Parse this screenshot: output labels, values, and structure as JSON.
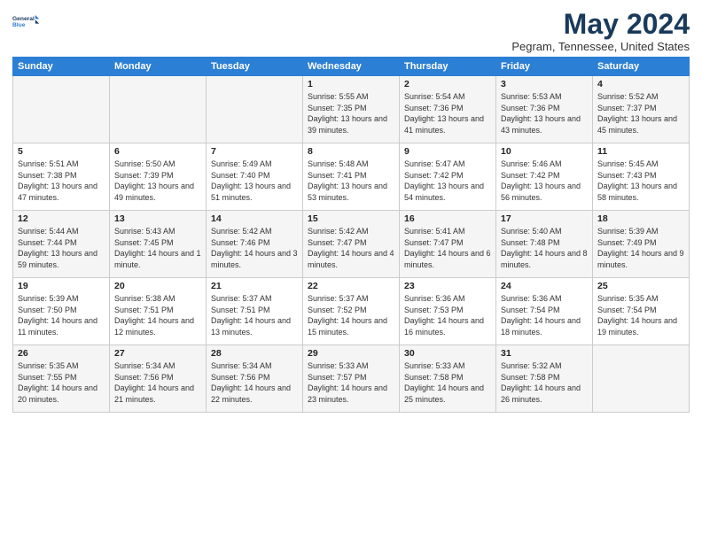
{
  "logo": {
    "line1": "General",
    "line2": "Blue"
  },
  "title": "May 2024",
  "subtitle": "Pegram, Tennessee, United States",
  "days_of_week": [
    "Sunday",
    "Monday",
    "Tuesday",
    "Wednesday",
    "Thursday",
    "Friday",
    "Saturday"
  ],
  "weeks": [
    [
      {
        "day": "",
        "info": ""
      },
      {
        "day": "",
        "info": ""
      },
      {
        "day": "",
        "info": ""
      },
      {
        "day": "1",
        "info": "Sunrise: 5:55 AM\nSunset: 7:35 PM\nDaylight: 13 hours\nand 39 minutes."
      },
      {
        "day": "2",
        "info": "Sunrise: 5:54 AM\nSunset: 7:36 PM\nDaylight: 13 hours\nand 41 minutes."
      },
      {
        "day": "3",
        "info": "Sunrise: 5:53 AM\nSunset: 7:36 PM\nDaylight: 13 hours\nand 43 minutes."
      },
      {
        "day": "4",
        "info": "Sunrise: 5:52 AM\nSunset: 7:37 PM\nDaylight: 13 hours\nand 45 minutes."
      }
    ],
    [
      {
        "day": "5",
        "info": "Sunrise: 5:51 AM\nSunset: 7:38 PM\nDaylight: 13 hours\nand 47 minutes."
      },
      {
        "day": "6",
        "info": "Sunrise: 5:50 AM\nSunset: 7:39 PM\nDaylight: 13 hours\nand 49 minutes."
      },
      {
        "day": "7",
        "info": "Sunrise: 5:49 AM\nSunset: 7:40 PM\nDaylight: 13 hours\nand 51 minutes."
      },
      {
        "day": "8",
        "info": "Sunrise: 5:48 AM\nSunset: 7:41 PM\nDaylight: 13 hours\nand 53 minutes."
      },
      {
        "day": "9",
        "info": "Sunrise: 5:47 AM\nSunset: 7:42 PM\nDaylight: 13 hours\nand 54 minutes."
      },
      {
        "day": "10",
        "info": "Sunrise: 5:46 AM\nSunset: 7:42 PM\nDaylight: 13 hours\nand 56 minutes."
      },
      {
        "day": "11",
        "info": "Sunrise: 5:45 AM\nSunset: 7:43 PM\nDaylight: 13 hours\nand 58 minutes."
      }
    ],
    [
      {
        "day": "12",
        "info": "Sunrise: 5:44 AM\nSunset: 7:44 PM\nDaylight: 13 hours\nand 59 minutes."
      },
      {
        "day": "13",
        "info": "Sunrise: 5:43 AM\nSunset: 7:45 PM\nDaylight: 14 hours\nand 1 minute."
      },
      {
        "day": "14",
        "info": "Sunrise: 5:42 AM\nSunset: 7:46 PM\nDaylight: 14 hours\nand 3 minutes."
      },
      {
        "day": "15",
        "info": "Sunrise: 5:42 AM\nSunset: 7:47 PM\nDaylight: 14 hours\nand 4 minutes."
      },
      {
        "day": "16",
        "info": "Sunrise: 5:41 AM\nSunset: 7:47 PM\nDaylight: 14 hours\nand 6 minutes."
      },
      {
        "day": "17",
        "info": "Sunrise: 5:40 AM\nSunset: 7:48 PM\nDaylight: 14 hours\nand 8 minutes."
      },
      {
        "day": "18",
        "info": "Sunrise: 5:39 AM\nSunset: 7:49 PM\nDaylight: 14 hours\nand 9 minutes."
      }
    ],
    [
      {
        "day": "19",
        "info": "Sunrise: 5:39 AM\nSunset: 7:50 PM\nDaylight: 14 hours\nand 11 minutes."
      },
      {
        "day": "20",
        "info": "Sunrise: 5:38 AM\nSunset: 7:51 PM\nDaylight: 14 hours\nand 12 minutes."
      },
      {
        "day": "21",
        "info": "Sunrise: 5:37 AM\nSunset: 7:51 PM\nDaylight: 14 hours\nand 13 minutes."
      },
      {
        "day": "22",
        "info": "Sunrise: 5:37 AM\nSunset: 7:52 PM\nDaylight: 14 hours\nand 15 minutes."
      },
      {
        "day": "23",
        "info": "Sunrise: 5:36 AM\nSunset: 7:53 PM\nDaylight: 14 hours\nand 16 minutes."
      },
      {
        "day": "24",
        "info": "Sunrise: 5:36 AM\nSunset: 7:54 PM\nDaylight: 14 hours\nand 18 minutes."
      },
      {
        "day": "25",
        "info": "Sunrise: 5:35 AM\nSunset: 7:54 PM\nDaylight: 14 hours\nand 19 minutes."
      }
    ],
    [
      {
        "day": "26",
        "info": "Sunrise: 5:35 AM\nSunset: 7:55 PM\nDaylight: 14 hours\nand 20 minutes."
      },
      {
        "day": "27",
        "info": "Sunrise: 5:34 AM\nSunset: 7:56 PM\nDaylight: 14 hours\nand 21 minutes."
      },
      {
        "day": "28",
        "info": "Sunrise: 5:34 AM\nSunset: 7:56 PM\nDaylight: 14 hours\nand 22 minutes."
      },
      {
        "day": "29",
        "info": "Sunrise: 5:33 AM\nSunset: 7:57 PM\nDaylight: 14 hours\nand 23 minutes."
      },
      {
        "day": "30",
        "info": "Sunrise: 5:33 AM\nSunset: 7:58 PM\nDaylight: 14 hours\nand 25 minutes."
      },
      {
        "day": "31",
        "info": "Sunrise: 5:32 AM\nSunset: 7:58 PM\nDaylight: 14 hours\nand 26 minutes."
      },
      {
        "day": "",
        "info": ""
      }
    ]
  ]
}
